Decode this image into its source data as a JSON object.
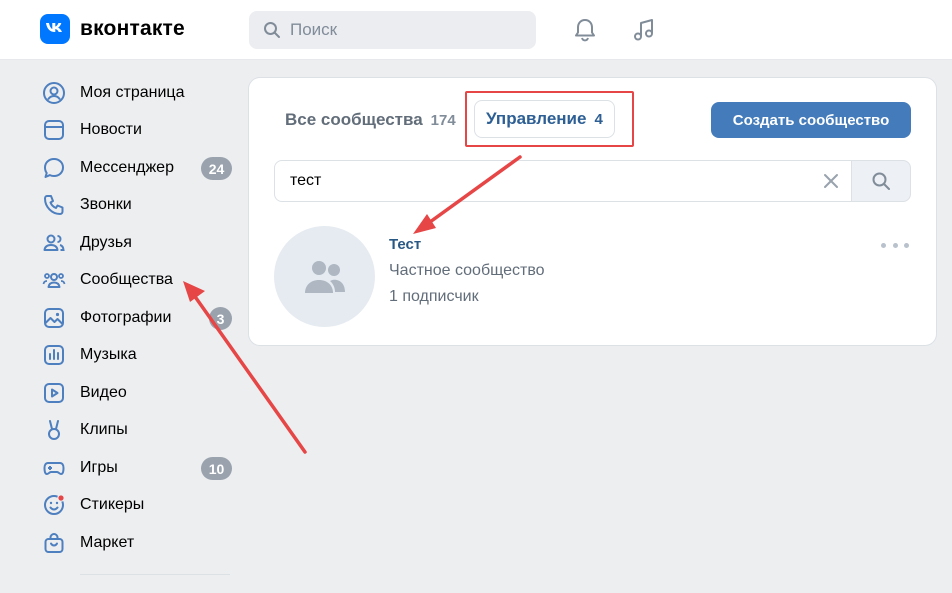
{
  "header": {
    "logo_text": "вконтакте",
    "search_placeholder": "Поиск"
  },
  "sidebar": {
    "items": [
      {
        "label": "Моя страница",
        "icon": "user-circle-icon"
      },
      {
        "label": "Новости",
        "icon": "newsfeed-icon"
      },
      {
        "label": "Мессенджер",
        "icon": "message-icon",
        "badge": "24"
      },
      {
        "label": "Звонки",
        "icon": "phone-icon"
      },
      {
        "label": "Друзья",
        "icon": "friends-icon"
      },
      {
        "label": "Сообщества",
        "icon": "communities-icon"
      },
      {
        "label": "Фотографии",
        "icon": "photo-icon",
        "badge": "3"
      },
      {
        "label": "Музыка",
        "icon": "music-icon"
      },
      {
        "label": "Видео",
        "icon": "video-icon"
      },
      {
        "label": "Клипы",
        "icon": "clips-icon"
      },
      {
        "label": "Игры",
        "icon": "game-icon",
        "badge": "10"
      },
      {
        "label": "Стикеры",
        "icon": "sticker-icon"
      },
      {
        "label": "Маркет",
        "icon": "market-icon"
      }
    ]
  },
  "main": {
    "tabs": [
      {
        "label": "Все сообщества",
        "count": "174"
      },
      {
        "label": "Управление",
        "count": "4"
      }
    ],
    "create_button": "Создать сообщество",
    "search_value": "тест",
    "group": {
      "name": "Тест",
      "type": "Частное сообщество",
      "subscribers": "1 подписчик"
    }
  },
  "colors": {
    "accent": "#447bba",
    "brand": "#0077ff",
    "annotation": "#e64646",
    "badge": "#99a2ad"
  }
}
